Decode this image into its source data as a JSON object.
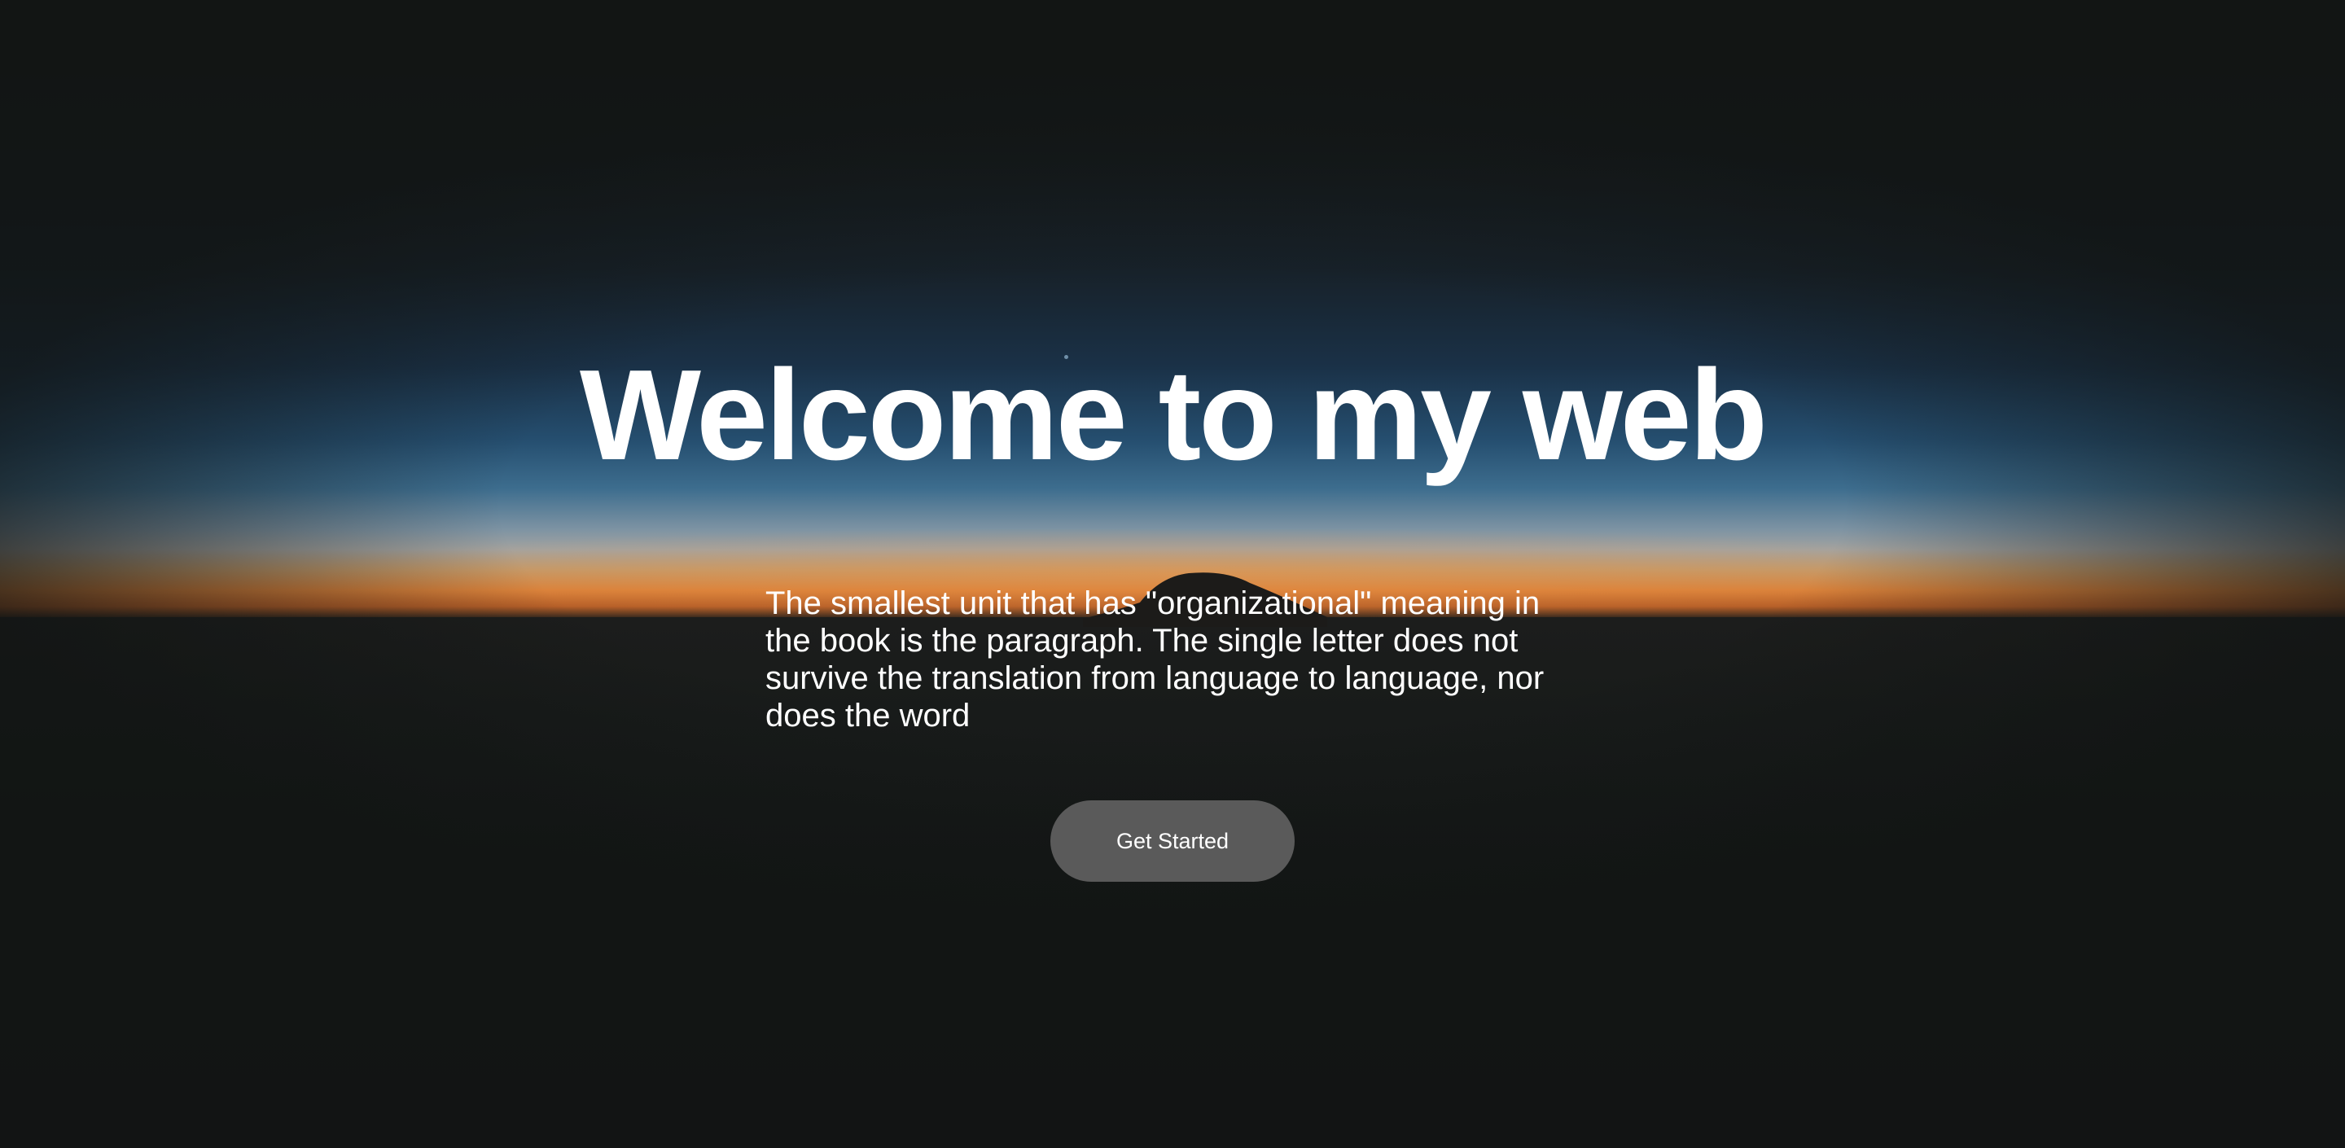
{
  "hero": {
    "title": "Welcome to my web",
    "paragraph": "The smallest unit that has \"organizational\" meaning in the book is the paragraph. The single letter does not survive the translation from language to language, nor does the word",
    "cta_label": "Get Started"
  },
  "colors": {
    "button_background": "#5a5a5a",
    "text": "#ffffff",
    "page_background": "#141716"
  }
}
